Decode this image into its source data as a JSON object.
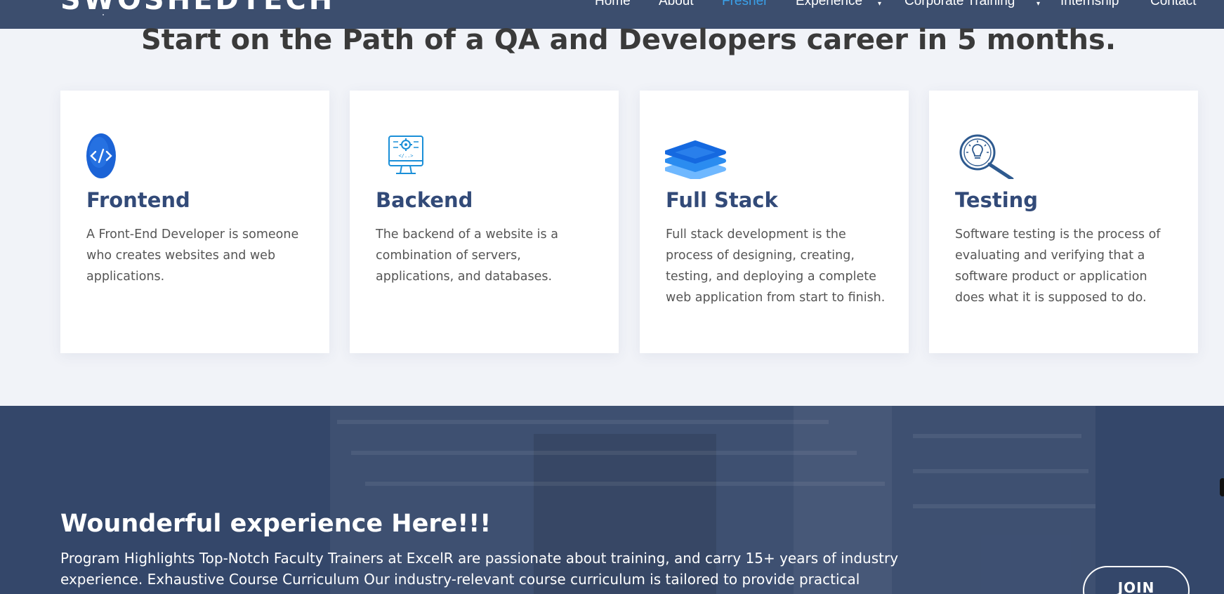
{
  "brand": {
    "logo_text": "SWOSHEDTECH"
  },
  "nav": {
    "items": [
      {
        "label": "Home"
      },
      {
        "label": "About"
      },
      {
        "label": "Fresher"
      },
      {
        "label": "Experience"
      },
      {
        "label": "Corporate Training"
      },
      {
        "label": "Internship"
      },
      {
        "label": "Contact"
      }
    ],
    "active": "Fresher",
    "accent_color": "#3aa0e8"
  },
  "section": {
    "headline": "Start on the Path of a QA and Developers career in 5 months."
  },
  "cards": [
    {
      "icon": "code-icon",
      "title": "Frontend",
      "text": "A Front-End Developer is someone who creates websites and web applications."
    },
    {
      "icon": "monitor-gear-icon",
      "title": "Backend",
      "text": "The backend of a website is a combination of servers, applications, and databases."
    },
    {
      "icon": "layers-icon",
      "title": "Full Stack",
      "text": "Full stack development is the process of designing, creating, testing, and deploying a complete web application from start to finish."
    },
    {
      "icon": "search-bulb-icon",
      "title": "Testing",
      "text": "Software testing is the process of evaluating and verifying that a software product or application does what it is supposed to do."
    }
  ],
  "banner": {
    "title": "Wounderful experience Here!!!",
    "text": "Program Highlights Top-Notch Faculty Trainers at ExcelR are passionate about training, and carry 15+ years of industry experience. Exhaustive Course Curriculum Our industry-relevant course curriculum is tailored to provide practical exposure with",
    "button_label": "JOIN"
  },
  "colors": {
    "header_bg": "#3c4e6e",
    "card_title": "#324a78",
    "banner_bg": "#34476a",
    "page_bg": "#f1f3f8"
  }
}
